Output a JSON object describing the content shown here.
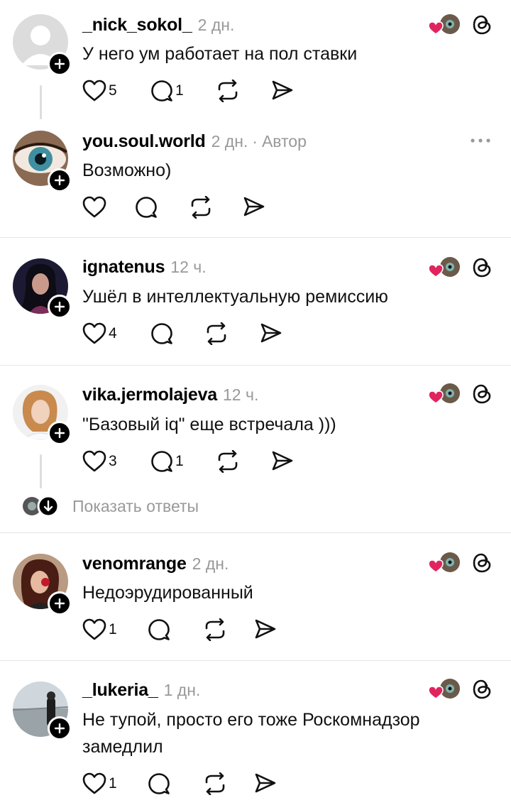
{
  "posts": [
    {
      "username": "_nick_sokol_",
      "time": "2 дн.",
      "text": "У него ум работает на пол ставки",
      "likes": "5",
      "replies": "1",
      "author_label": ""
    },
    {
      "username": "you.soul.world",
      "time": "2 дн.",
      "author_label": "Автор",
      "text": "Возможно)",
      "likes": "",
      "replies": ""
    },
    {
      "username": "ignatenus",
      "time": "12 ч.",
      "text": "Ушёл в интеллектуальную ремиссию",
      "likes": "4",
      "replies": "",
      "author_label": ""
    },
    {
      "username": "vika.jermolajeva",
      "time": "12 ч.",
      "text": "\"Базовый iq\" еще встречала )))",
      "likes": "3",
      "replies": "1",
      "author_label": ""
    },
    {
      "username": "venomrange",
      "time": "2 дн.",
      "text": "Недоэрудированный",
      "likes": "1",
      "replies": "",
      "author_label": ""
    },
    {
      "username": "_lukeria_",
      "time": "1 дн.",
      "text": "Не тупой, просто его тоже Роскомнадзор замедлил",
      "likes": "1",
      "replies": "",
      "author_label": ""
    }
  ],
  "show_replies_label": "Показать ответы",
  "separator": "·",
  "icons": [
    "heart-icon",
    "comment-icon",
    "repost-icon",
    "share-icon",
    "liked-by-author-icon",
    "threads-logo-icon",
    "more-icon",
    "follow-plus-icon",
    "arrow-down-icon"
  ],
  "colors": {
    "muted": "#999999",
    "heart": "#e0245e",
    "text": "#111111"
  }
}
